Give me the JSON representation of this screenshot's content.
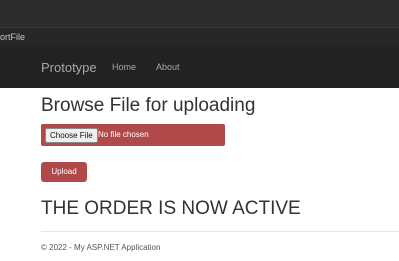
{
  "window": {
    "tab_label": "ortFile"
  },
  "navbar": {
    "brand": "Prototype",
    "links": [
      {
        "label": "Home"
      },
      {
        "label": "About"
      }
    ]
  },
  "main": {
    "heading": "Browse File for uploading",
    "file_input": {
      "button_label": "Choose File",
      "status": "No file chosen"
    },
    "upload_label": "Upload",
    "status_message": "THE ORDER IS NOW ACTIVE"
  },
  "footer": {
    "text": "© 2022 - My ASP.NET Application"
  },
  "colors": {
    "navbar_bg": "#222222",
    "accent": "#b04a4a",
    "text": "#333333"
  }
}
